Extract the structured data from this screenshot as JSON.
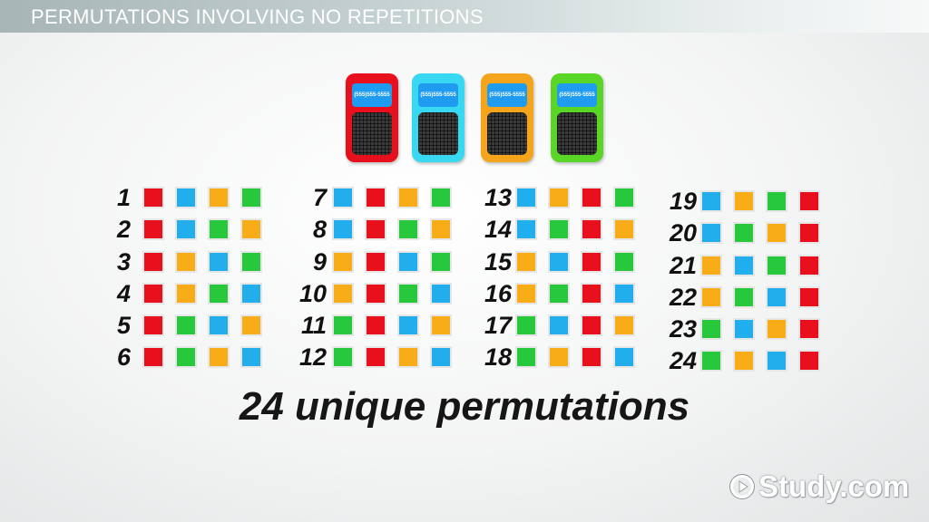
{
  "header": {
    "title": "PERMUTATIONS INVOLVING NO REPETITIONS"
  },
  "colors": {
    "red": "#e8101c",
    "blue": "#22adec",
    "orange": "#f7ac18",
    "green": "#28c83c"
  },
  "phones": [
    {
      "name": "red-phone",
      "color": "red",
      "body": "#e8101c",
      "screen_text": "(555)555-5555"
    },
    {
      "name": "blue-phone",
      "color": "blue",
      "body": "#38d8f2",
      "screen_text": "(555)555-5555"
    },
    {
      "name": "orange-phone",
      "color": "orange",
      "body": "#f5a51c",
      "screen_text": "(555)555-5555"
    },
    {
      "name": "green-phone",
      "color": "green",
      "body": "#5ad626",
      "screen_text": "(555)555-5555"
    }
  ],
  "permutations": [
    {
      "label": "1",
      "order": [
        "red",
        "blue",
        "orange",
        "green"
      ]
    },
    {
      "label": "2",
      "order": [
        "red",
        "blue",
        "green",
        "orange"
      ]
    },
    {
      "label": "3",
      "order": [
        "red",
        "orange",
        "blue",
        "green"
      ]
    },
    {
      "label": "4",
      "order": [
        "red",
        "orange",
        "green",
        "blue"
      ]
    },
    {
      "label": "5",
      "order": [
        "red",
        "green",
        "blue",
        "orange"
      ]
    },
    {
      "label": "6",
      "order": [
        "red",
        "green",
        "orange",
        "blue"
      ]
    },
    {
      "label": "7",
      "order": [
        "blue",
        "red",
        "orange",
        "green"
      ]
    },
    {
      "label": "8",
      "order": [
        "blue",
        "red",
        "green",
        "orange"
      ]
    },
    {
      "label": "9",
      "order": [
        "orange",
        "red",
        "blue",
        "green"
      ]
    },
    {
      "label": "10",
      "order": [
        "orange",
        "red",
        "green",
        "blue"
      ]
    },
    {
      "label": "11",
      "order": [
        "green",
        "red",
        "blue",
        "orange"
      ]
    },
    {
      "label": "12",
      "order": [
        "green",
        "red",
        "orange",
        "blue"
      ]
    },
    {
      "label": "13",
      "order": [
        "blue",
        "orange",
        "red",
        "green"
      ]
    },
    {
      "label": "14",
      "order": [
        "blue",
        "green",
        "red",
        "orange"
      ]
    },
    {
      "label": "15",
      "order": [
        "orange",
        "blue",
        "red",
        "green"
      ]
    },
    {
      "label": "16",
      "order": [
        "orange",
        "green",
        "red",
        "blue"
      ]
    },
    {
      "label": "17",
      "order": [
        "green",
        "blue",
        "red",
        "orange"
      ]
    },
    {
      "label": "18",
      "order": [
        "green",
        "orange",
        "red",
        "blue"
      ]
    },
    {
      "label": "19",
      "order": [
        "blue",
        "orange",
        "green",
        "red"
      ]
    },
    {
      "label": "20",
      "order": [
        "blue",
        "green",
        "orange",
        "red"
      ]
    },
    {
      "label": "21",
      "order": [
        "orange",
        "blue",
        "green",
        "red"
      ]
    },
    {
      "label": "22",
      "order": [
        "orange",
        "green",
        "blue",
        "red"
      ]
    },
    {
      "label": "23",
      "order": [
        "green",
        "blue",
        "orange",
        "red"
      ]
    },
    {
      "label": "24",
      "order": [
        "green",
        "orange",
        "blue",
        "red"
      ]
    }
  ],
  "summary": "24 unique permutations",
  "logo": {
    "text": "Study.com"
  }
}
